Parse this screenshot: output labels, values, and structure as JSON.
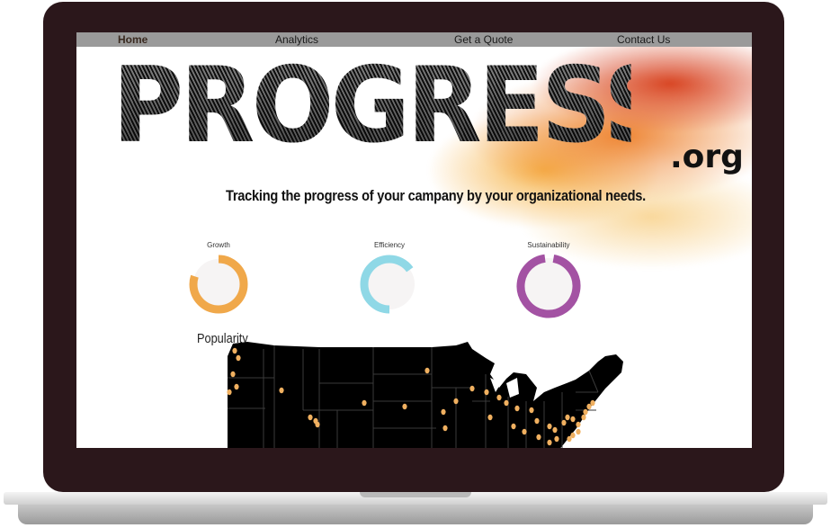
{
  "nav": {
    "items": [
      {
        "label": "Home",
        "active": true
      },
      {
        "label": "Analytics",
        "active": false
      },
      {
        "label": "Get a Quote",
        "active": false
      },
      {
        "label": "Contact Us",
        "active": false
      }
    ]
  },
  "brand": {
    "logo_text": "PROGRESS",
    "logo_suffix": ".org",
    "tagline": "Tracking the progress of your campany by your organizational needs."
  },
  "metrics": [
    {
      "label": "Growth",
      "progress": 0.8,
      "color": "#f0a84a"
    },
    {
      "label": "Efficiency",
      "progress": 0.65,
      "color": "#8fd8e6"
    },
    {
      "label": "Sustainability",
      "progress": 0.95,
      "color": "#a352a3"
    }
  ],
  "map": {
    "title": "Popularity",
    "marker_color": "#f0b060",
    "land_color": "#000000",
    "border_color": "#3a3a3a"
  },
  "colors": {
    "bezel": "#2b171b",
    "nav_bar": "#9a9a9a",
    "splash_orange": "#ec7a1e",
    "splash_red": "#d63c19"
  }
}
